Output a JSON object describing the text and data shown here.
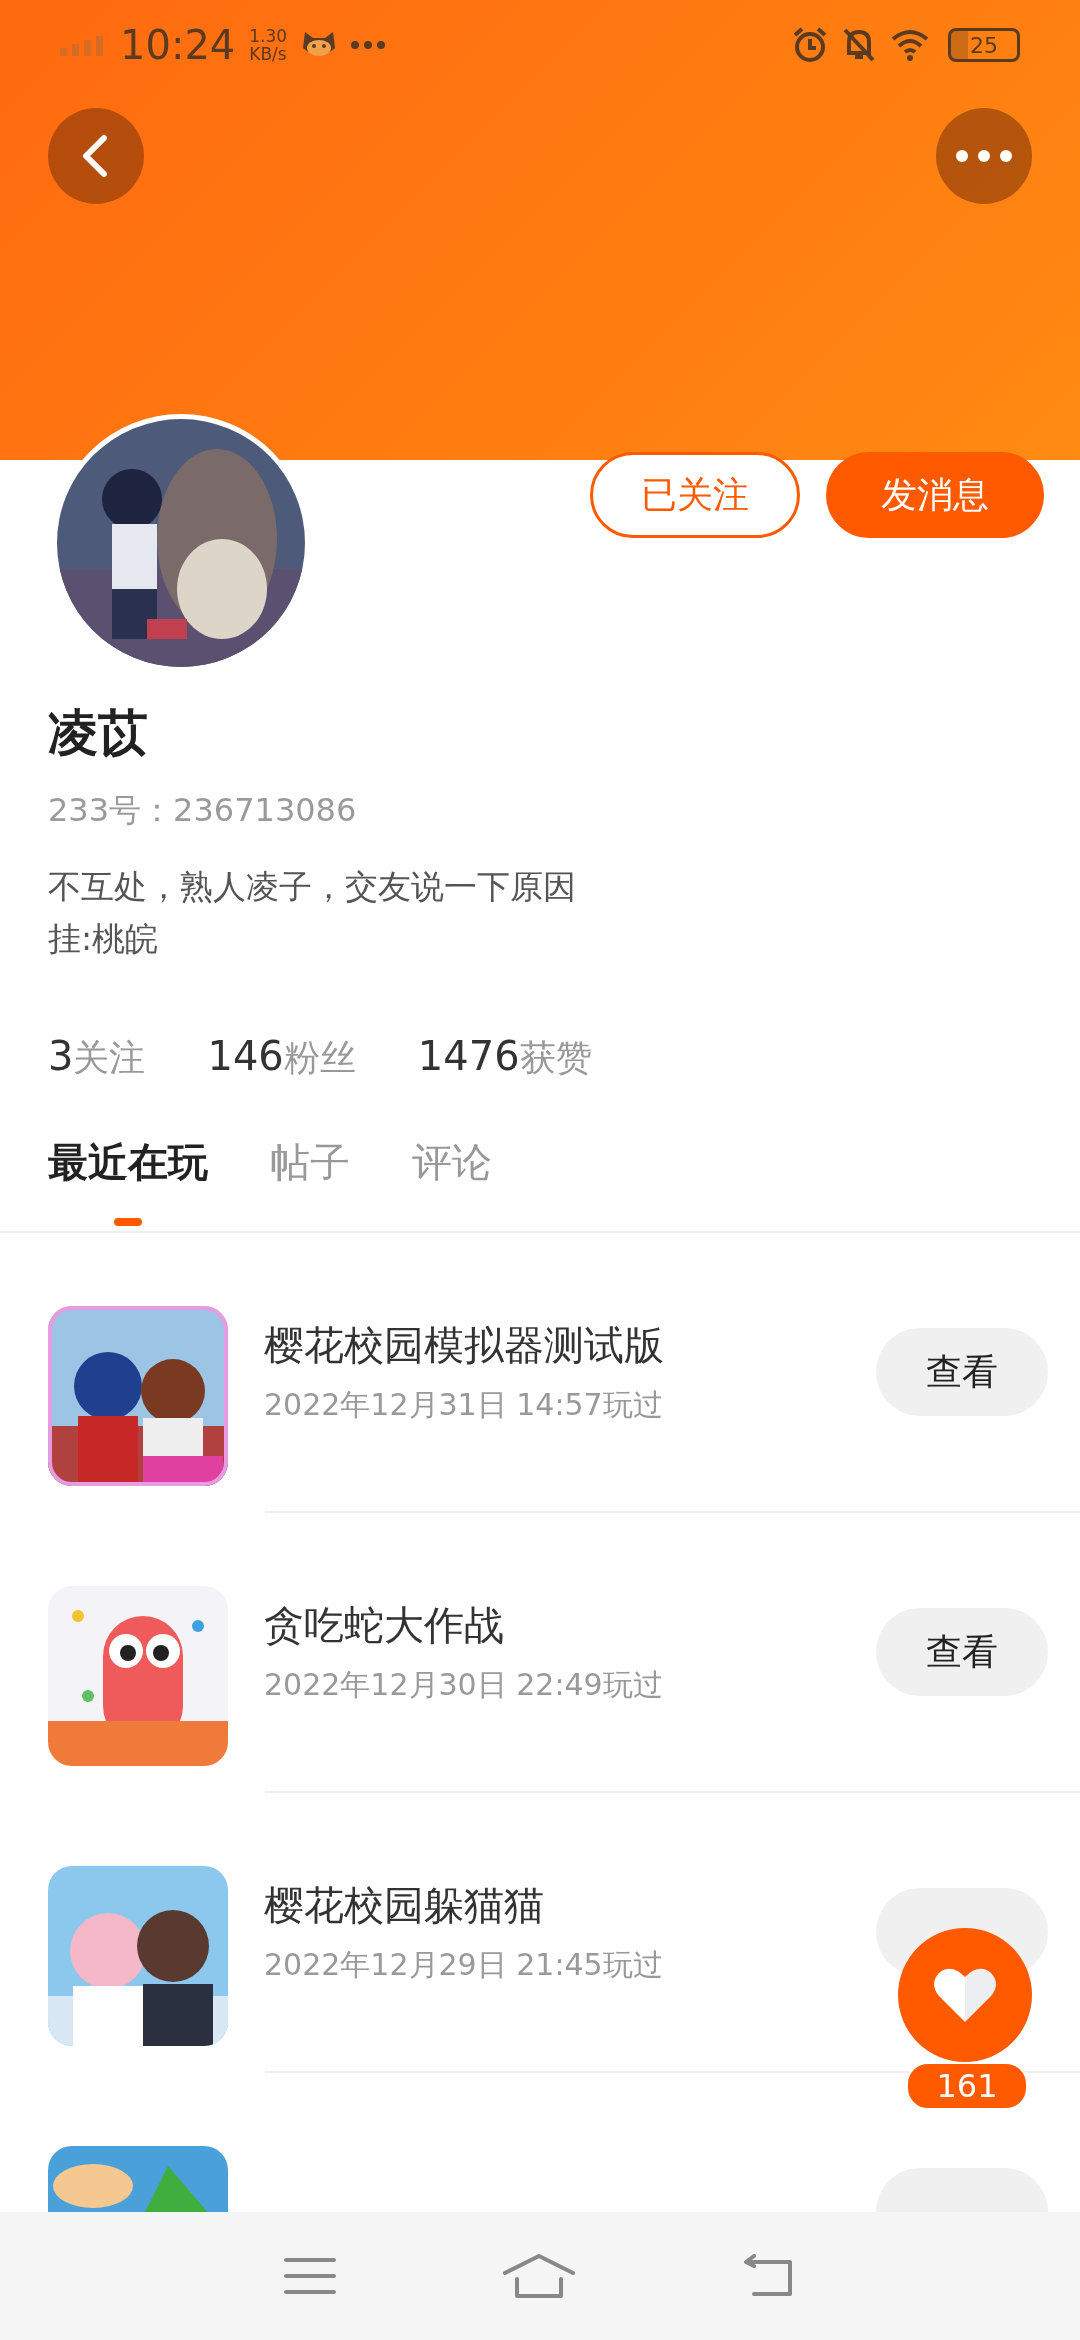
{
  "status_bar": {
    "time": "10:24",
    "speed_value": "1.30",
    "speed_unit": "KB/s",
    "battery": "25"
  },
  "profile": {
    "follow_button": "已关注",
    "followed": true,
    "message_button": "发消息",
    "name": "凌苡",
    "id_label": "233号：",
    "id_value": "236713086",
    "bio": [
      "不互处，熟人凌子，交友说一下原因",
      "挂:桃皖"
    ]
  },
  "stats": [
    "3关注",
    "146粉丝",
    "1476获赞"
  ],
  "tabs": [
    {
      "label": "最近在玩",
      "selected": true
    },
    {
      "label": "帖子",
      "selected": false
    },
    {
      "label": "评论",
      "selected": false
    }
  ],
  "games": [
    {
      "title": "樱花校园模拟器测试版",
      "played": "2022年12月31日 14:57玩过",
      "action": "查看",
      "kind": "picture"
    },
    {
      "title": "贪吃蛇大作战",
      "played": "2022年12月30日 22:49玩过",
      "action": "查看",
      "kind": "picture"
    },
    {
      "title": "樱花校园躲猫猫",
      "played": "2022年12月29日 21:45玩过",
      "kind": "picture"
    },
    {
      "kind": "picture"
    }
  ],
  "like_count": "161"
}
